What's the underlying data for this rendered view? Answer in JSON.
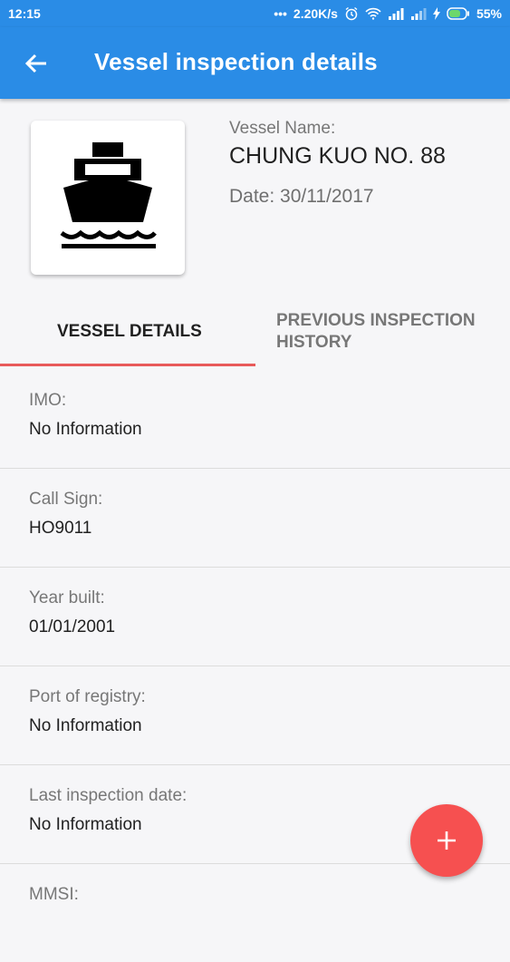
{
  "status_bar": {
    "time": "12:15",
    "dots": "•••",
    "network_speed": "2.20K/s",
    "battery": "55%"
  },
  "app_bar": {
    "title": "Vessel inspection details",
    "back_icon": "arrow-back-icon"
  },
  "vessel": {
    "name_label": "Vessel Name:",
    "name": "CHUNG KUO NO. 88",
    "date": "Date: 30/11/2017",
    "image_icon": "ship-icon"
  },
  "tabs": [
    {
      "label": "VESSEL DETAILS",
      "active": true
    },
    {
      "label": "PREVIOUS INSPECTION HISTORY",
      "active": false
    }
  ],
  "details": [
    {
      "label": "IMO:",
      "value": "No Information"
    },
    {
      "label": "Call Sign:",
      "value": "HO9011"
    },
    {
      "label": "Year built:",
      "value": "01/01/2001"
    },
    {
      "label": "Port of registry:",
      "value": "No Information"
    },
    {
      "label": "Last inspection date:",
      "value": "No Information"
    },
    {
      "label": "MMSI:",
      "value": ""
    }
  ],
  "fab": {
    "icon": "add-icon"
  },
  "colors": {
    "primary": "#2a8ce6",
    "accent": "#f65050",
    "tab_indicator": "#e85a5a"
  }
}
